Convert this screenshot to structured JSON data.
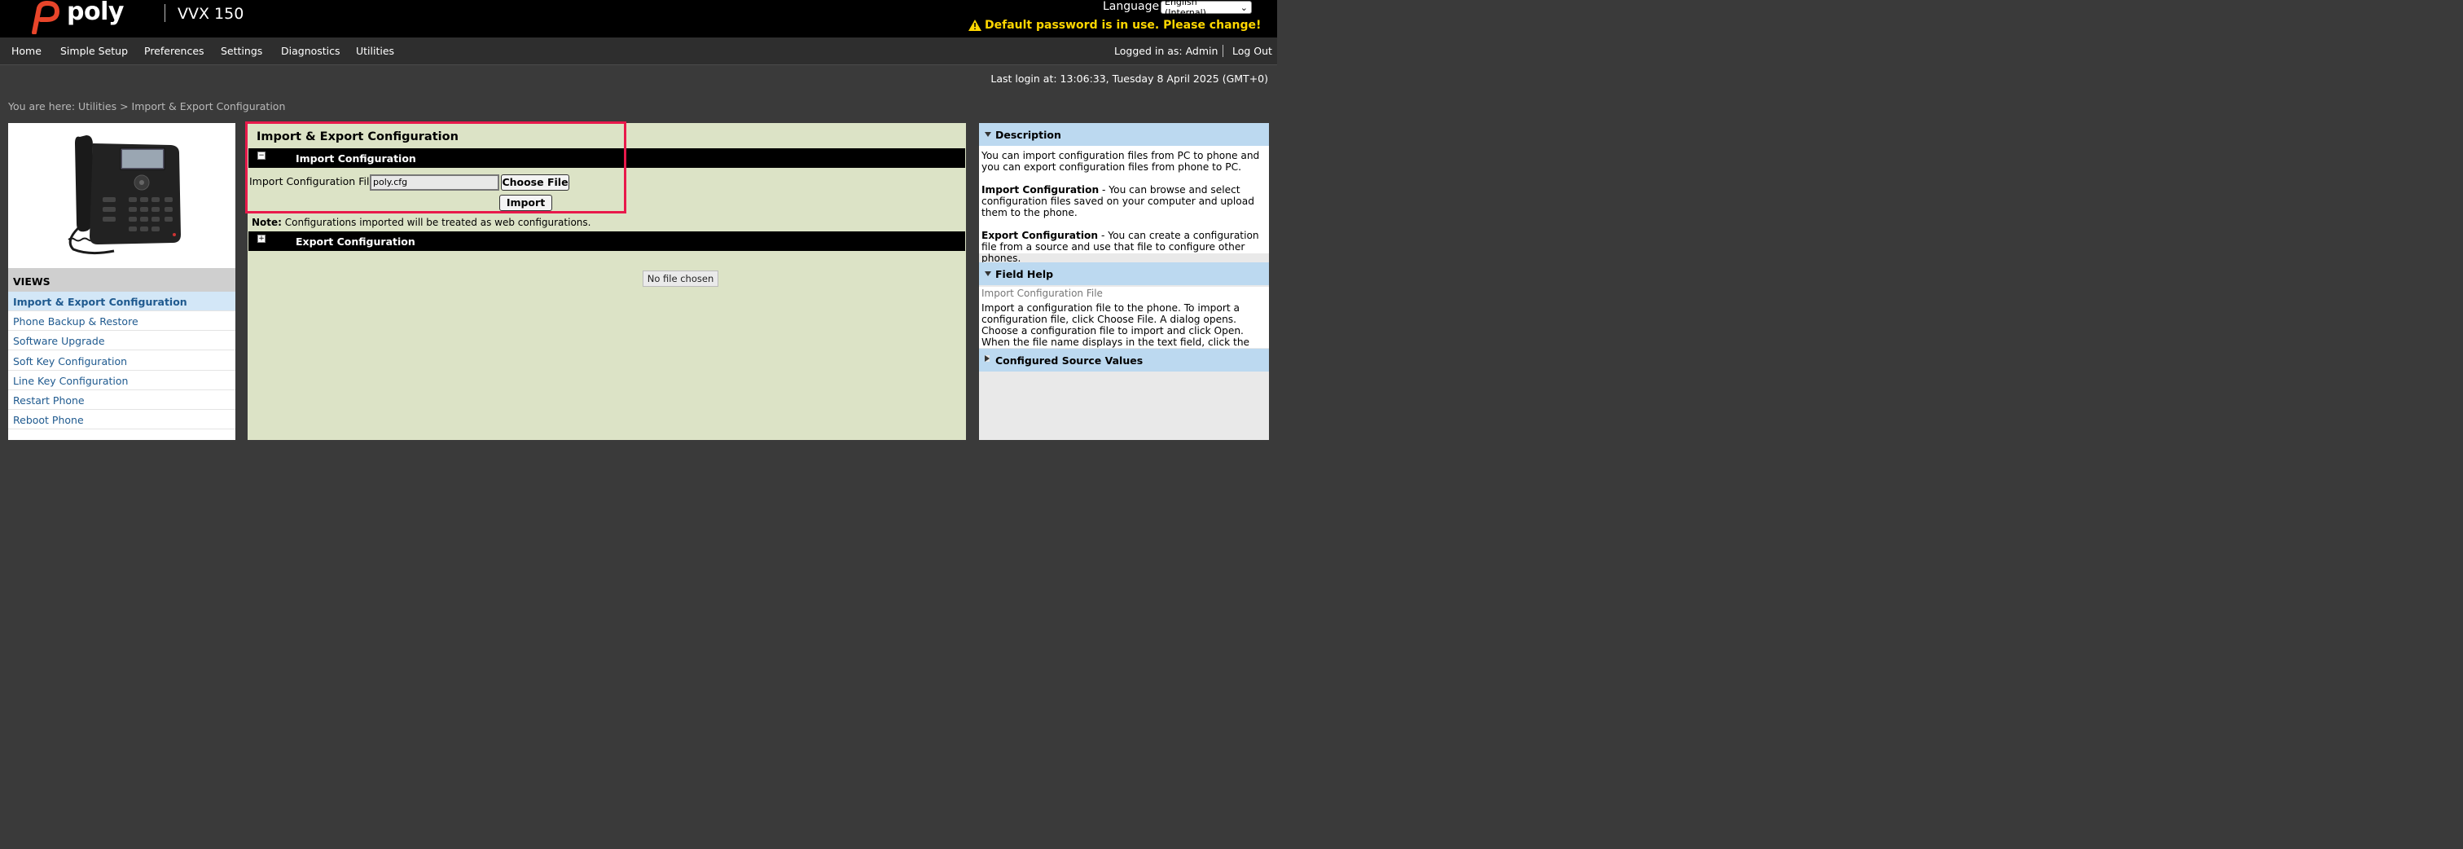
{
  "header": {
    "brand": "poly",
    "model": "VVX 150",
    "language_label": "Language",
    "language_selected": "English (Internal)",
    "warning": "Default password is in use. Please change!"
  },
  "nav": {
    "items": [
      "Home",
      "Simple Setup",
      "Preferences",
      "Settings",
      "Diagnostics",
      "Utilities"
    ],
    "logged_in": "Logged in as: Admin",
    "logout": "Log Out"
  },
  "last_login": "Last login at: 13:06:33, Tuesday 8 April 2025 (GMT+0)",
  "breadcrumb": "You are here: Utilities > Import & Export Configuration",
  "sidebar": {
    "views_title": "VIEWS",
    "items": [
      {
        "label": "Import & Export Configuration",
        "active": true
      },
      {
        "label": "Phone Backup & Restore",
        "active": false
      },
      {
        "label": "Software Upgrade",
        "active": false
      },
      {
        "label": "Soft Key Configuration",
        "active": false
      },
      {
        "label": "Line Key Configuration",
        "active": false
      },
      {
        "label": "Restart Phone",
        "active": false
      },
      {
        "label": "Reboot Phone",
        "active": false
      }
    ]
  },
  "main": {
    "title": "Import & Export Configuration",
    "import_section": "Import Configuration",
    "import_field_label": "Import Configuration File",
    "import_file_value": "poly.cfg",
    "choose_file": "Choose File",
    "import_button": "Import",
    "note_label": "Note:",
    "note_text": " Configurations imported will be treated as web configurations.",
    "export_section": "Export Configuration",
    "tooltip": "No file chosen",
    "toggle_collapse": "−",
    "toggle_expand": "+"
  },
  "right": {
    "description_title": "Description",
    "description_p1": "You can import configuration files from PC to phone and you can export configuration files from phone to PC.",
    "import_term": "Import Configuration",
    "import_desc": " - You can browse and select configuration files saved on your computer and upload them to the phone.",
    "export_term": "Export Configuration",
    "export_desc": " - You can create a configuration file from a source and use that file to configure other phones.",
    "field_help_title": "Field Help",
    "field_help_subtitle": "Import Configuration File",
    "field_help_text": "Import a configuration file to the phone. To import a configuration file, click Choose File. A dialog opens. Choose a configuration file to import and click Open. When the file name displays in the text field, click the Import button.",
    "configured_title": "Configured Source Values"
  },
  "colors": {
    "accent_red": "#e8194b",
    "warning_yellow": "#ffd700",
    "link_blue": "#1f5a8f",
    "panel_green": "#dce3c6",
    "right_header_blue": "#bcd9f0"
  }
}
